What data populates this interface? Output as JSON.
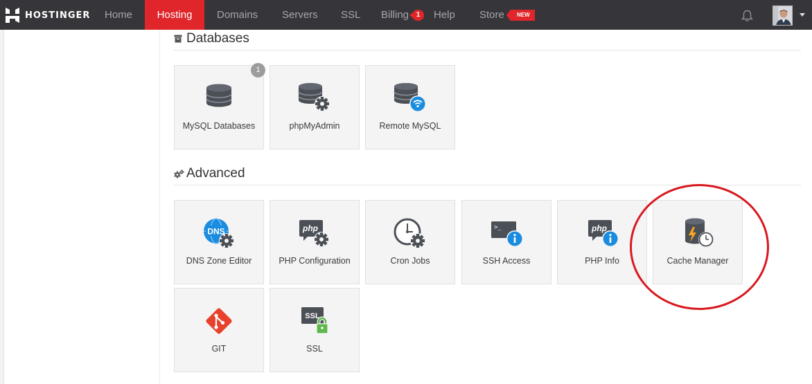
{
  "brand": {
    "name": "HOSTINGER"
  },
  "nav": {
    "items": [
      "Home",
      "Hosting",
      "Domains",
      "Servers",
      "SSL",
      "Billing",
      "Help",
      "Store"
    ],
    "active": "Hosting",
    "billing_badge": "1",
    "store_tag": "NEW"
  },
  "databases": {
    "title": "Databases",
    "tiles": [
      {
        "label": "MySQL Databases",
        "icon": "database-icon",
        "badge": "1"
      },
      {
        "label": "phpMyAdmin",
        "icon": "database-gear-icon"
      },
      {
        "label": "Remote MySQL",
        "icon": "database-wifi-icon"
      }
    ]
  },
  "advanced": {
    "title": "Advanced",
    "tiles": [
      {
        "label": "DNS Zone Editor",
        "icon": "dns-globe-gear-icon"
      },
      {
        "label": "PHP Configuration",
        "icon": "php-gear-icon"
      },
      {
        "label": "Cron Jobs",
        "icon": "clock-gear-icon"
      },
      {
        "label": "SSH Access",
        "icon": "terminal-info-icon"
      },
      {
        "label": "PHP Info",
        "icon": "php-info-icon"
      },
      {
        "label": "Cache Manager",
        "icon": "cache-clock-icon",
        "highlighted": true
      },
      {
        "label": "GIT",
        "icon": "git-icon"
      },
      {
        "label": "SSL",
        "icon": "ssl-lock-icon"
      }
    ]
  },
  "colors": {
    "accent": "#e0262a",
    "topbar": "#36363a",
    "icon_dark": "#4b4f56",
    "info_blue": "#1a8ce0",
    "git_red": "#e8412c",
    "lock_green": "#5cb84a"
  }
}
